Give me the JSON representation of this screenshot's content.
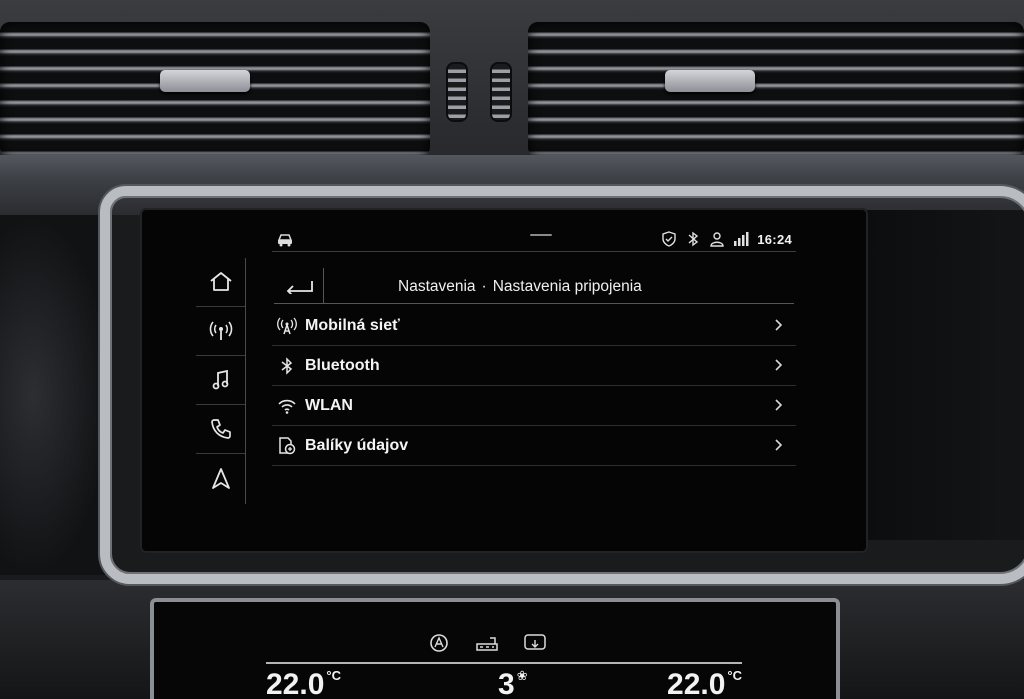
{
  "status_bar": {
    "time": "16:24",
    "left_icon": "car-status-icon",
    "icons": [
      "shield-check-icon",
      "bluetooth-icon",
      "user-icon",
      "signal-icon"
    ]
  },
  "nav_rail": {
    "items": [
      {
        "name": "home-icon"
      },
      {
        "name": "antenna-icon"
      },
      {
        "name": "music-note-icon"
      },
      {
        "name": "phone-icon"
      },
      {
        "name": "navigation-arrow-icon"
      }
    ]
  },
  "header": {
    "breadcrumb_parent": "Nastavenia",
    "separator": "·",
    "breadcrumb_current": "Nastavenia pripojenia"
  },
  "menu": {
    "items": [
      {
        "label": "Mobilná sieť",
        "icon": "mobile-network-icon"
      },
      {
        "label": "Bluetooth",
        "icon": "bluetooth-icon"
      },
      {
        "label": "WLAN",
        "icon": "wifi-icon"
      },
      {
        "label": "Balíky údajov",
        "icon": "data-package-icon"
      }
    ]
  },
  "climate": {
    "temp_left": "22.0",
    "temp_right": "22.0",
    "temp_unit": "°C",
    "fan_level": "3"
  },
  "colors": {
    "screen_bg": "#050506",
    "text": "#f4f4f4",
    "divider": "#2e2e31",
    "chrome": "#b9bcc1"
  }
}
